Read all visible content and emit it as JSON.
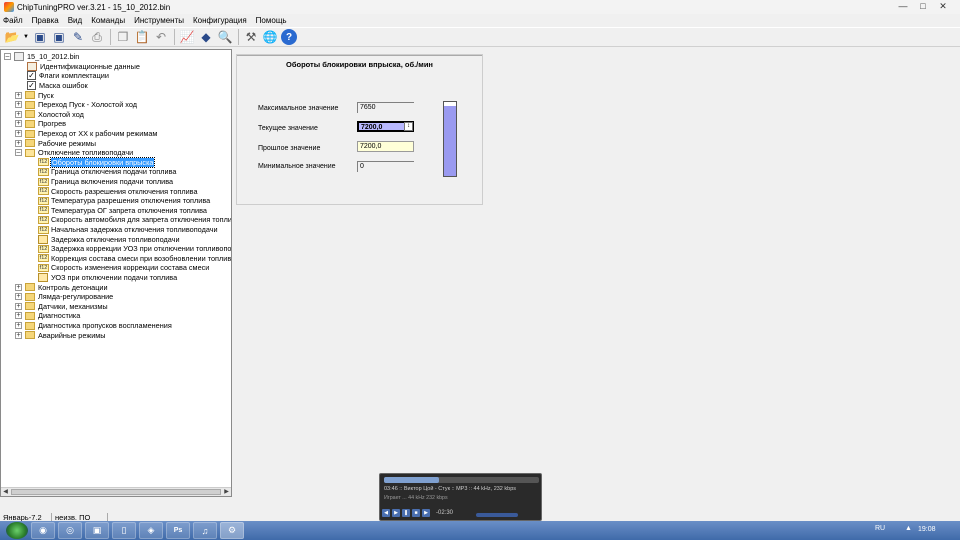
{
  "window": {
    "title": "ChipTuningPRO ver.3.21 - 15_10_2012.bin",
    "controls": [
      "minimize-icon",
      "maximize-icon",
      "close-icon"
    ]
  },
  "menu": [
    "Файл",
    "Правка",
    "Вид",
    "Команды",
    "Инструменты",
    "Конфигурация",
    "Помощь"
  ],
  "toolbar": {
    "icons": [
      "open-folder-icon",
      "dropdown-arrow-icon",
      "save-icon",
      "save-as-icon",
      "write-icon",
      "print-icon",
      "copy-icon",
      "paste-icon",
      "undo-icon",
      "chart-icon",
      "diamond-icon",
      "search-icon",
      "tools-icon",
      "ecu-icon",
      "help-icon"
    ]
  },
  "tree": {
    "root": "15_10_2012.bin",
    "items": [
      {
        "label": "Идентификационные данные",
        "icon": "doc"
      },
      {
        "label": "Флаги комплектации",
        "icon": "check"
      },
      {
        "label": "Маска ошибок",
        "icon": "check"
      },
      {
        "label": "Пуск",
        "icon": "folder"
      },
      {
        "label": "Переход Пуск - Холостой ход",
        "icon": "folder"
      },
      {
        "label": "Холостой ход",
        "icon": "folder"
      },
      {
        "label": "Прогрев",
        "icon": "folder"
      },
      {
        "label": "Переход от ХХ к рабочим режимам",
        "icon": "folder"
      },
      {
        "label": "Рабочие режимы",
        "icon": "folder"
      },
      {
        "label": "Отключение топливоподачи",
        "icon": "folder-open"
      },
      {
        "label": "Обороты блокировки впрыска",
        "icon": "f12"
      },
      {
        "label": "Граница отключения подачи топлива",
        "icon": "f12"
      },
      {
        "label": "Граница включения подачи топлива",
        "icon": "f12"
      },
      {
        "label": "Скорость разрешения отключения топлива",
        "icon": "f12"
      },
      {
        "label": "Температура разрешения отключения топлива",
        "icon": "f12"
      },
      {
        "label": "Температура ОГ запрета отключения топлива",
        "icon": "f12"
      },
      {
        "label": "Скорость автомобиля для запрета отключения топлива",
        "icon": "f12"
      },
      {
        "label": "Начальная задержка отключения топливоподачи",
        "icon": "f12"
      },
      {
        "label": "Задержка отключения топливоподачи",
        "icon": "table"
      },
      {
        "label": "Задержка коррекции УОЗ при отключении топливоподачи",
        "icon": "f12"
      },
      {
        "label": "Коррекция состава смеси при возобновлении топливоподачи",
        "icon": "f12"
      },
      {
        "label": "Скорость изменения коррекции состава смеси",
        "icon": "f12"
      },
      {
        "label": "УОЗ при отключении подачи топлива",
        "icon": "table"
      },
      {
        "label": "Контроль детонации",
        "icon": "folder"
      },
      {
        "label": "Лямда-регулирование",
        "icon": "folder"
      },
      {
        "label": "Датчики, механизмы",
        "icon": "folder"
      },
      {
        "label": "Диагностика",
        "icon": "folder"
      },
      {
        "label": "Диагностика пропусков воспламенения",
        "icon": "folder"
      },
      {
        "label": "Аварийные режимы",
        "icon": "folder"
      }
    ],
    "f12_label": "f12"
  },
  "panel": {
    "title": "Обороты блокировки впрыска, об./мин",
    "max_label": "Максимальное значение",
    "max_value": "7650",
    "current_label": "Текущее значение",
    "current_value": "7200,0",
    "previous_label": "Прошлое значение",
    "previous_value": "7200,0",
    "min_label": "Минимальное значение",
    "min_value": "0",
    "gauge_fraction": 0.94
  },
  "status": {
    "ecu": "Январь-7.2",
    "software": "неизв. ПО"
  },
  "player": {
    "track": "03:46 :: Виктор Цой - Стук :: MP3 :: 44 kHz, 232 kbps",
    "status": "Играет ... 44 kHz   232 kbps",
    "time": "-02:30"
  },
  "taskbar": {
    "language": "RU",
    "clock": "19:08"
  }
}
